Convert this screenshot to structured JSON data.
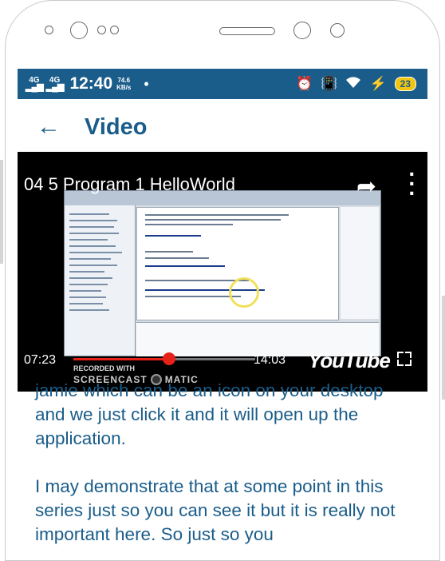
{
  "status_bar": {
    "network_left": "4G",
    "network_right": "4G",
    "time": "12:40",
    "speed_value": "74.6",
    "speed_unit": "KB/s",
    "battery": "23"
  },
  "app_bar": {
    "title": "Video"
  },
  "video": {
    "title": "04 5 Program 1 HelloWorld",
    "current_time": "07:23",
    "total_time": "14:03",
    "progress": 0.525,
    "logo_text": "YouTube",
    "recorded_with": "RECORDED WITH",
    "screencast_left": "SCREENCAST",
    "screencast_right": "MATIC"
  },
  "transcript": {
    "paragraph_1": "jamie which can be an icon  on your desktop and we just click it and it will open up the application.",
    "paragraph_2": "I may demonstrate that at some point in this series just so you can see it but it is really not important here.  So just so you"
  },
  "colors": {
    "primary": "#1a5d8a",
    "progress": "#e62117"
  }
}
